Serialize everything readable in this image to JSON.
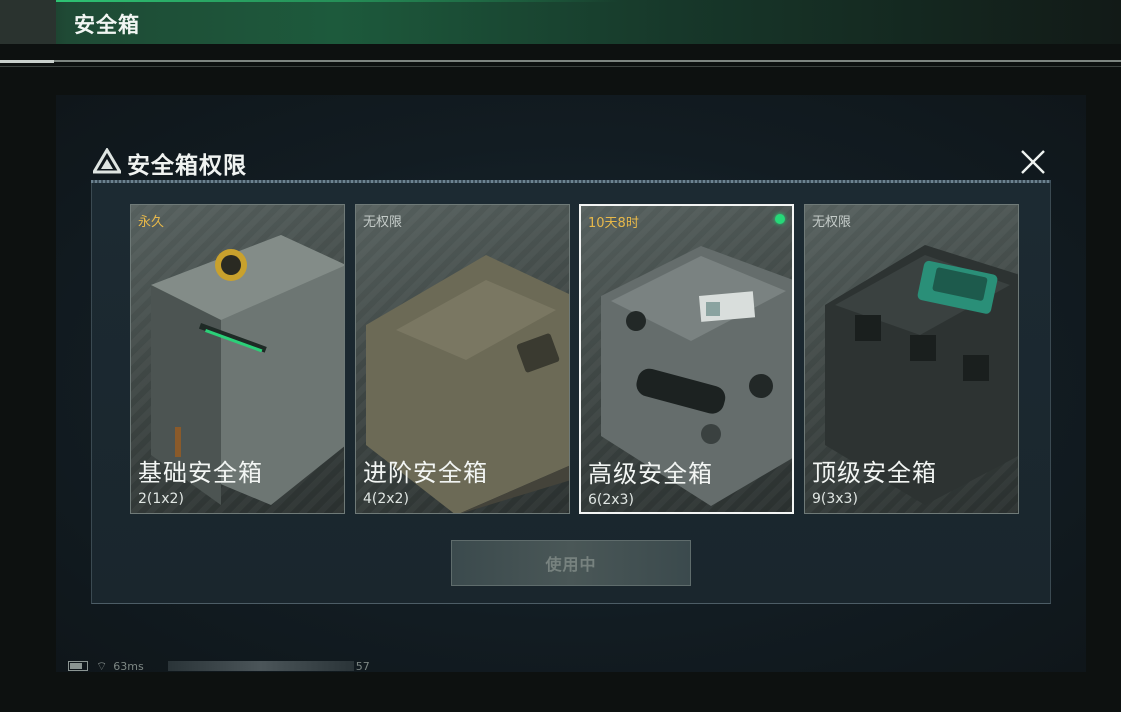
{
  "topbar": {
    "title": "安全箱"
  },
  "dialog": {
    "title": "安全箱权限",
    "cards": [
      {
        "status": "永久",
        "status_color": "#e7b84a",
        "name": "基础安全箱",
        "capacity": "2(1x2)",
        "selected": false,
        "active": false
      },
      {
        "status": "无权限",
        "status_color": "#c5ccc9",
        "name": "进阶安全箱",
        "capacity": "4(2x2)",
        "selected": false,
        "active": false
      },
      {
        "status": "10天8时",
        "status_color": "#e7b84a",
        "name": "高级安全箱",
        "capacity": "6(2x3)",
        "selected": true,
        "active": true
      },
      {
        "status": "无权限",
        "status_color": "#c5ccc9",
        "name": "顶级安全箱",
        "capacity": "9(3x3)",
        "selected": false,
        "active": false
      }
    ],
    "use_button": "使用中"
  },
  "footer": {
    "ping": "63ms",
    "trailing": "57"
  },
  "colors": {
    "accent_green": "#26d878",
    "gold": "#e7b84a"
  }
}
